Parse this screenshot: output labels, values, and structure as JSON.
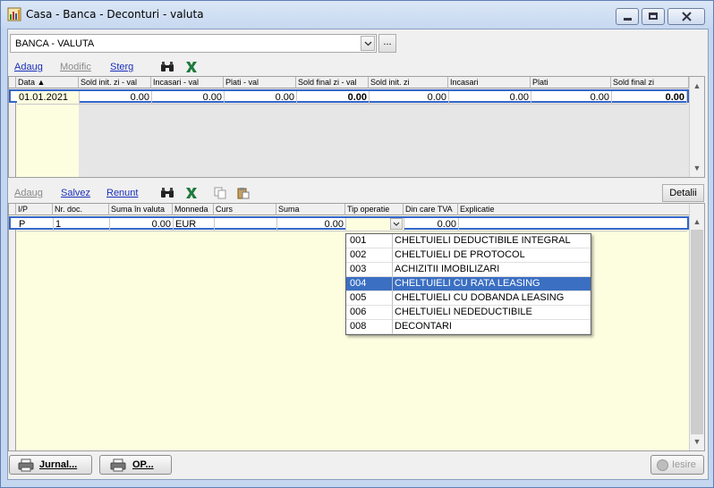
{
  "window": {
    "title": "Casa - Banca - Deconturi - valuta",
    "minimize_icon": "minimize-icon",
    "maximize_icon": "maximize-icon",
    "close_icon": "close-icon"
  },
  "account_select": {
    "value": "BANCA - VALUTA",
    "more_label": "..."
  },
  "top_toolbar": {
    "add_label": "Adaug",
    "edit_label": "Modific",
    "delete_label": "Sterg",
    "search_icon": "binoculars-icon",
    "excel_icon": "excel-icon"
  },
  "top_grid": {
    "columns": [
      "Data ▲",
      "Sold init. zi - val",
      "Incasari - val",
      "Plati - val",
      "Sold final zi - val",
      "Sold init. zi",
      "Incasari",
      "Plati",
      "Sold final zi"
    ],
    "rows": [
      [
        "01.01.2021",
        "0.00",
        "0.00",
        "0.00",
        "0.00",
        "0.00",
        "0.00",
        "0.00",
        "0.00"
      ]
    ]
  },
  "bottom_toolbar": {
    "add_label": "Adaug",
    "save_label": "Salvez",
    "cancel_label": "Renunt",
    "search_icon": "binoculars-icon",
    "excel_icon": "excel-icon",
    "copy_icon": "copy-icon",
    "paste_icon": "paste-icon",
    "details_label": "Detalii"
  },
  "bottom_grid": {
    "columns": [
      "I/P",
      "Nr. doc.",
      "Suma în valuta",
      "Monneda",
      "Curs",
      "Suma",
      "Tip operatie",
      "Din care TVA",
      "Explicatie"
    ],
    "rows": [
      [
        "P",
        "1",
        "0.00",
        "EUR",
        "",
        "0.00",
        "",
        "0.00",
        ""
      ]
    ]
  },
  "operation_dropdown": {
    "items": [
      {
        "code": "001",
        "name": "CHELTUIELI DEDUCTIBILE INTEGRAL"
      },
      {
        "code": "002",
        "name": "CHELTUIELI DE PROTOCOL"
      },
      {
        "code": "003",
        "name": "ACHIZITII IMOBILIZARI"
      },
      {
        "code": "004",
        "name": "CHELTUIELI CU RATA LEASING"
      },
      {
        "code": "005",
        "name": "CHELTUIELI CU DOBANDA LEASING"
      },
      {
        "code": "006",
        "name": "CHELTUIELI NEDEDUCTIBILE"
      },
      {
        "code": "008",
        "name": "DECONTARI"
      }
    ],
    "selected_code": "004"
  },
  "footer": {
    "journal_label": "Jurnal...",
    "op_label": "OP...",
    "exit_label": "Iesire",
    "print_icon": "printer-icon",
    "exit_icon": "exit-icon"
  },
  "colors": {
    "selected_row": "#3b6fc2",
    "focus_border": "#3366cc",
    "yellow_column": "#fdfde0",
    "link": "#1a2fb8"
  }
}
